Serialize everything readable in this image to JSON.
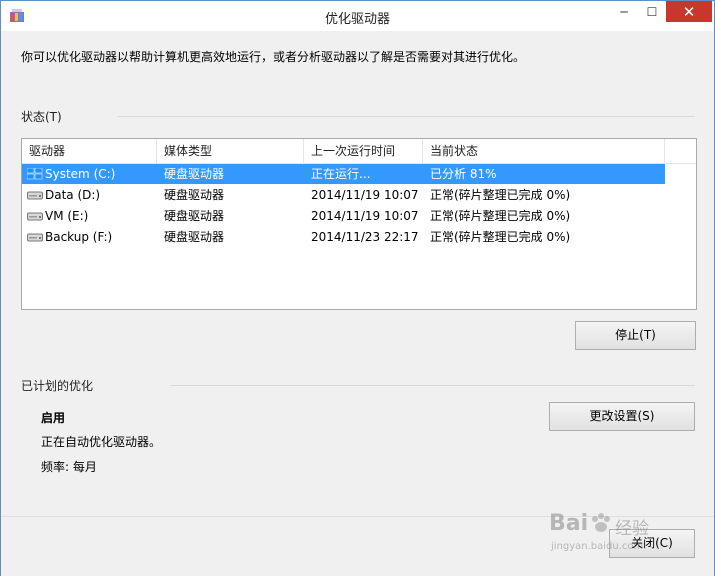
{
  "window": {
    "title": "优化驱动器"
  },
  "title_buttons": {
    "minimize": "─",
    "maximize": "☐",
    "close": "✕"
  },
  "intro_text": "你可以优化驱动器以帮助计算机更高效地运行，或者分析驱动器以了解是否需要对其进行优化。",
  "status_section": {
    "label": "状态(T)"
  },
  "columns": [
    "驱动器",
    "媒体类型",
    "上一次运行时间",
    "当前状态"
  ],
  "drives": [
    {
      "name": "System (C:)",
      "media": "硬盘驱动器",
      "last_run": "正在运行...",
      "status": "已分析 81%",
      "icon": "windows-drive-icon",
      "selected": true
    },
    {
      "name": "Data (D:)",
      "media": "硬盘驱动器",
      "last_run": "2014/11/19 10:07",
      "status": "正常(碎片整理已完成 0%)",
      "icon": "hard-drive-icon",
      "selected": false
    },
    {
      "name": "VM (E:)",
      "media": "硬盘驱动器",
      "last_run": "2014/11/19 10:07",
      "status": "正常(碎片整理已完成 0%)",
      "icon": "hard-drive-icon",
      "selected": false
    },
    {
      "name": "Backup (F:)",
      "media": "硬盘驱动器",
      "last_run": "2014/11/23 22:17",
      "status": "正常(碎片整理已完成 0%)",
      "icon": "hard-drive-icon",
      "selected": false
    }
  ],
  "buttons": {
    "stop": "停止(T)",
    "change_settings": "更改设置(S)",
    "close": "关闭(C)"
  },
  "scheduled": {
    "label": "已计划的优化",
    "state": "启用",
    "description": "正在自动优化驱动器。",
    "frequency": "频率: 每月"
  },
  "watermark": {
    "brand": "Bai",
    "brand_suffix": "经验",
    "domain": "jingyan.baidu.com"
  },
  "colors": {
    "selection": "#3399ff",
    "close_button": "#c7372d",
    "border": "#5f8fc0"
  }
}
